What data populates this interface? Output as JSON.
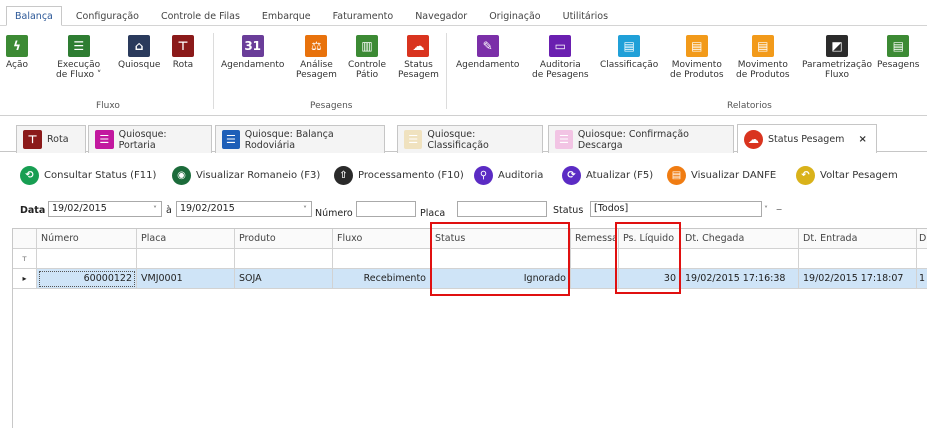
{
  "menu": {
    "tabs": [
      "Balança",
      "Configuração",
      "Controle de Filas",
      "Embarque",
      "Faturamento",
      "Navegador",
      "Originação",
      "Utilitários"
    ],
    "active_index": 0
  },
  "ribbon": {
    "groups": {
      "fluxo": "Fluxo",
      "pesagens": "Pesagens",
      "relatorios": "Relatorios"
    },
    "buttons": {
      "acao": "Ação",
      "execucao_fluxo": [
        "Execução",
        "de Fluxo ˅"
      ],
      "quiosque": "Quiosque",
      "rota": "Rota",
      "agendamento": "Agendamento",
      "analise_pesagem": [
        "Análise",
        "Pesagem"
      ],
      "controle_patio": [
        "Controle",
        "Pátio"
      ],
      "status_pesagem": [
        "Status",
        "Pesagem"
      ],
      "agendamento2": "Agendamento",
      "auditoria_pesagens": [
        "Auditoria",
        "de Pesagens"
      ],
      "classificacao": "Classificação",
      "movimento_produtos_1": [
        "Movimento",
        "de Produtos"
      ],
      "movimento_produtos_2": [
        "Movimento",
        "de Produtos"
      ],
      "parametrizacao_fluxo": [
        "Parametrização",
        "Fluxo"
      ],
      "pesagens": "Pesagens"
    }
  },
  "doc_tabs": {
    "rota": "Rota",
    "quiosque_portaria": "Quiosque: Portaria",
    "quiosque_balanca": "Quiosque: Balança Rodoviária",
    "quiosque_classificacao": "Quiosque: Classificação",
    "quiosque_confirmacao": "Quiosque: Confirmação Descarga",
    "status_pesagem": "Status Pesagem",
    "close_glyph": "×"
  },
  "toolbar": {
    "consultar": "Consultar Status (F11)",
    "visualizar_romaneio": "Visualizar Romaneio (F3)",
    "processamento": "Processamento (F10)",
    "auditoria": "Auditoria",
    "atualizar": "Atualizar (F5)",
    "visualizar_danfe": "Visualizar DANFE",
    "voltar_pesagem": "Voltar Pesagem"
  },
  "filters": {
    "data_label": "Data",
    "data_from": "19/02/2015",
    "to_label": "à",
    "data_to": "19/02/2015",
    "numero_label": "Número",
    "numero_value": "",
    "placa_label": "Placa",
    "placa_value": "",
    "status_label": "Status",
    "status_value": "[Todos]",
    "arrow": "˅",
    "clear": "−"
  },
  "grid": {
    "columns": {
      "numero": "Número",
      "placa": "Placa",
      "produto": "Produto",
      "fluxo": "Fluxo",
      "status": "Status",
      "remessa": "Remessa",
      "ps_liquido": "Ps. Líquido",
      "dt_chegada": "Dt. Chegada",
      "dt_entrada": "Dt. Entrada",
      "extra": "D"
    },
    "filter_row_glyph": "ᴛ",
    "row_indicator": "▸",
    "row": {
      "numero": "60000122",
      "placa": "VMJ0001",
      "produto": "SOJA",
      "fluxo": "Recebimento",
      "status": "Ignorado",
      "remessa": "",
      "ps_liquido": "30",
      "dt_chegada": "19/02/2015 17:16:38",
      "dt_entrada": "19/02/2015 17:18:07",
      "extra": "1"
    }
  },
  "colors": {
    "highlight": "#e01010",
    "selected_row": "#cfe4f7",
    "accent_blue": "#2b5797"
  }
}
